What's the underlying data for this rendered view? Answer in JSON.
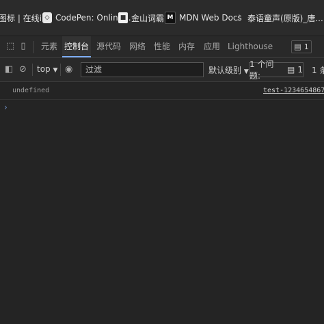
{
  "bookmarks": [
    {
      "label": "图标 | 在线i..",
      "icon": "bookmark-icon"
    },
    {
      "label": "CodePen: Online...",
      "icon": "codepen-icon"
    },
    {
      "label": "金山词霸",
      "icon": "jinshan-icon"
    },
    {
      "label": "MDN Web Docs",
      "icon": "mdn-icon"
    },
    {
      "label": "泰语童声(原版)_唐...",
      "icon": "tai-icon"
    }
  ],
  "devtools": {
    "tabs": [
      "元素",
      "控制台",
      "源代码",
      "网络",
      "性能",
      "内存",
      "应用",
      "Lighthouse"
    ],
    "active_tab": "控制台",
    "message_count": "1"
  },
  "console_toolbar": {
    "context": "top",
    "filter_placeholder": "过滤",
    "levels_label": "默认级别",
    "issues_label": "1 个问题:",
    "issues_count": "1",
    "hidden_label": "1 条"
  },
  "console": {
    "output": "undefined",
    "source": "test-12346548678.",
    "prompt": "›"
  }
}
